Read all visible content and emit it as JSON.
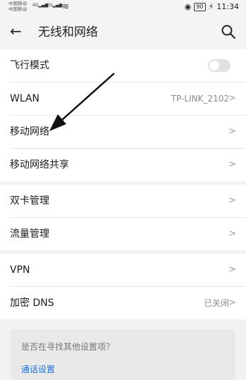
{
  "status_bar": {
    "carrier1": "中国移动",
    "carrier2": "中国移动",
    "net1": "4G",
    "net2": "2G",
    "battery": "90",
    "time": "11:34"
  },
  "header": {
    "title": "无线和网络",
    "back_icon": "back-arrow",
    "search_icon": "search"
  },
  "groups": [
    {
      "items": [
        {
          "label": "飞行模式",
          "type": "toggle",
          "on": false
        },
        {
          "label": "WLAN",
          "value": "TP-LINK_2102"
        },
        {
          "label": "移动网络"
        },
        {
          "label": "移动网络共享"
        }
      ]
    },
    {
      "items": [
        {
          "label": "双卡管理"
        },
        {
          "label": "流量管理"
        }
      ]
    },
    {
      "items": [
        {
          "label": "VPN"
        },
        {
          "label": "加密 DNS",
          "value": "已关闭"
        }
      ]
    }
  ],
  "suggestion": {
    "question": "是否在寻找其他设置项？",
    "link": "通话设置"
  },
  "colors": {
    "link": "#1e6fd9",
    "background": "#f2f2f2"
  }
}
